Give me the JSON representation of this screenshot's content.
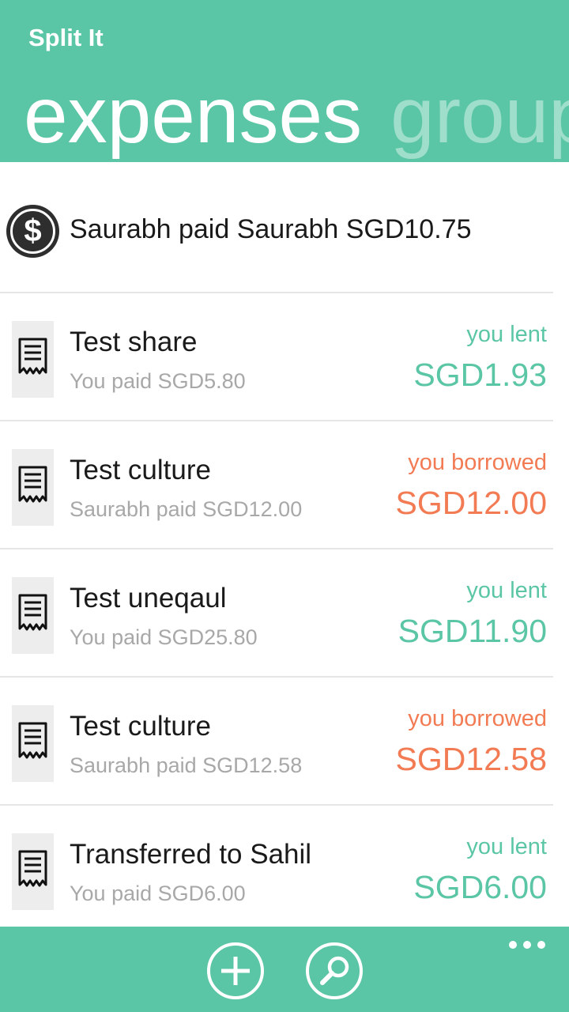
{
  "app": {
    "title": "Split It"
  },
  "pivot": {
    "items": [
      "expenses",
      "groups"
    ],
    "active": "expenses"
  },
  "colors": {
    "accent": "#5bc6a5",
    "lent": "#5bc6a5",
    "borrowed": "#f27b54"
  },
  "settlement": {
    "icon": "dollar-icon",
    "text": "Saurabh paid Saurabh SGD10.75"
  },
  "expenses": [
    {
      "icon": "receipt-icon",
      "title": "Test share",
      "subtitle": "You paid SGD5.80",
      "status": "you lent",
      "amount": "SGD1.93"
    },
    {
      "icon": "receipt-icon",
      "title": "Test culture",
      "subtitle": "Saurabh paid SGD12.00",
      "status": "you borrowed",
      "amount": "SGD12.00"
    },
    {
      "icon": "receipt-icon",
      "title": "Test uneqaul",
      "subtitle": "You paid SGD25.80",
      "status": "you lent",
      "amount": "SGD11.90"
    },
    {
      "icon": "receipt-icon",
      "title": "Test culture",
      "subtitle": "Saurabh paid SGD12.58",
      "status": "you borrowed",
      "amount": "SGD12.58"
    },
    {
      "icon": "receipt-icon",
      "title": "Transferred to Sahil",
      "subtitle": "You paid SGD6.00",
      "status": "you lent",
      "amount": "SGD6.00"
    }
  ],
  "appbar": {
    "buttons": [
      "add-icon",
      "search-icon"
    ],
    "more": "more-icon"
  }
}
